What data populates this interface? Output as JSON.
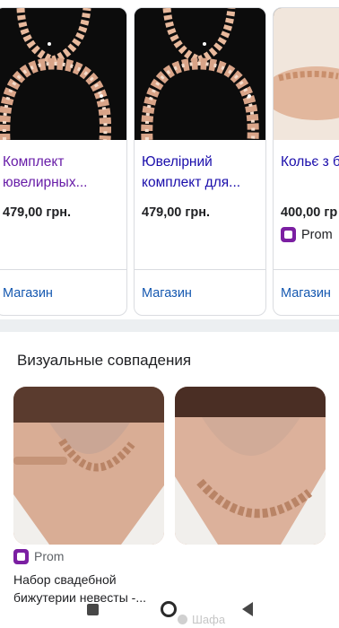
{
  "products": [
    {
      "title": "Комплект ювелирных...",
      "price": "479,00 грн.",
      "seller": "",
      "shop": "Магазин",
      "visited": true
    },
    {
      "title": "Ювелірний комплект для...",
      "price": "479,00 грн.",
      "seller": "",
      "shop": "Магазин",
      "visited": false
    },
    {
      "title": "Кольє з браслето",
      "price": "400,00 гр",
      "seller": "Prom",
      "shop": "Магазин",
      "visited": false
    }
  ],
  "visual_matches": {
    "heading": "Визуальные совпадения",
    "items": [
      {
        "source": "Prom",
        "description": "Набор свадебной бижутерии невесты -..."
      },
      {
        "source": "Шафа",
        "description": ""
      }
    ]
  },
  "colors": {
    "visited_link": "#681da8",
    "link": "#1a0dab",
    "shop_link": "#1558b0",
    "prom_brand": "#7b1fa2"
  },
  "icons": [
    "prom-logo-icon",
    "shafa-logo-icon",
    "recents-icon",
    "home-icon",
    "back-icon"
  ]
}
